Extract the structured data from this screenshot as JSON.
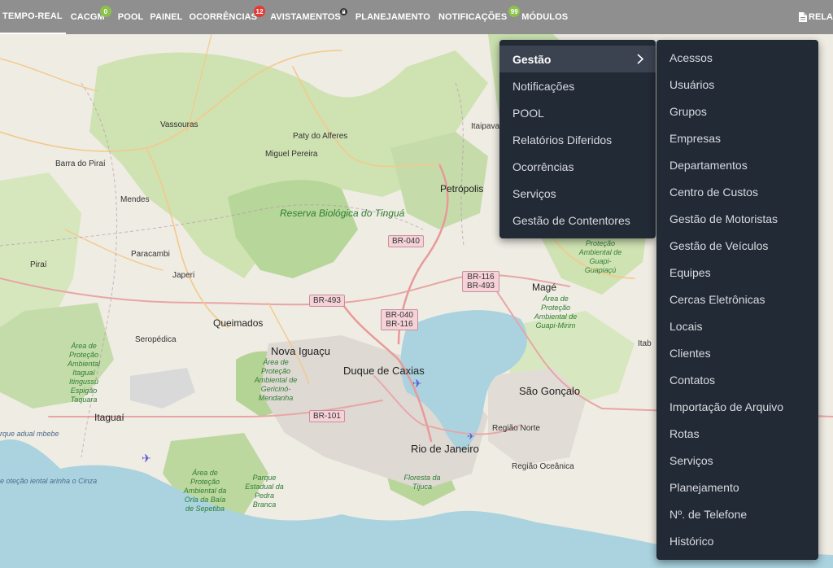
{
  "topbar": {
    "items": [
      {
        "label": "TEMPO-REAL"
      },
      {
        "label": "CACGM",
        "badge": "0"
      },
      {
        "label": "POOL"
      },
      {
        "label": "PAINEL"
      },
      {
        "label": "OCORRÊNCIAS",
        "badge": "12"
      },
      {
        "label": "AVISTAMENTOS"
      },
      {
        "label": "PLANEJAMENTO"
      },
      {
        "label": "NOTIFICAÇÕES",
        "badge": "99"
      },
      {
        "label": "MÓDULOS"
      }
    ],
    "right_label": "RELA",
    "colors": {
      "bar": "#8f8f8f",
      "badge_green": "#8bc34a",
      "badge_red": "#e53935"
    }
  },
  "menu": {
    "items": [
      {
        "label": "Gestão"
      },
      {
        "label": "Notificações"
      },
      {
        "label": "POOL"
      },
      {
        "label": "Relatórios Diferidos"
      },
      {
        "label": "Ocorrências"
      },
      {
        "label": "Serviços"
      },
      {
        "label": "Gestão de Contentores"
      }
    ]
  },
  "submenu": {
    "items": [
      {
        "label": "Acessos"
      },
      {
        "label": "Usuários"
      },
      {
        "label": "Grupos"
      },
      {
        "label": "Empresas"
      },
      {
        "label": "Departamentos"
      },
      {
        "label": "Centro de Custos"
      },
      {
        "label": "Gestão de Motoristas"
      },
      {
        "label": "Gestão de Veículos"
      },
      {
        "label": "Equipes"
      },
      {
        "label": "Cercas Eletrônicas"
      },
      {
        "label": "Locais"
      },
      {
        "label": "Clientes"
      },
      {
        "label": "Contatos"
      },
      {
        "label": "Importação de Arquivo"
      },
      {
        "label": "Rotas"
      },
      {
        "label": "Serviços"
      },
      {
        "label": "Planejamento"
      },
      {
        "label": "Nº. de Telefone"
      },
      {
        "label": "Histórico"
      }
    ]
  },
  "map": {
    "places": {
      "vassouras": "Vassouras",
      "paty": "Paty do Alferes",
      "miguel": "Miguel Pereira",
      "barra": "Barra do Piraí",
      "mendes": "Mendes",
      "itaipava": "Itaipava",
      "petropolis": "Petrópolis",
      "reserva": "Reserva Biológica do Tinguá",
      "pirai": "Piraí",
      "paracambi": "Paracambi",
      "japeri": "Japeri",
      "queimados": "Queimados",
      "mage": "Magé",
      "seropedica": "Seropédica",
      "novaiguacu": "Nova Iguaçu",
      "caxias": "Duque de Caxias",
      "itaguai": "Itaguaí",
      "saogoncalo": "São Gonçalo",
      "rio": "Rio de Janeiro",
      "regiaonorte": "Região Norte",
      "regiaooceanica": "Região Oceânica",
      "itab": "Itab",
      "apa_itaguai": "Área de Proteção Ambiental Itaguaí Itingussú Espigão Taquara",
      "apa_gericino": "Área de Proteção Ambiental de Gericinó-Mendanha",
      "apa_guapi_g": "Proteção Ambiental de Guapi-Guapiaçú",
      "apa_guapi_m": "Área de Proteção Ambiental de Guapi-Mirim",
      "apa_orla": "Área de Proteção Ambiental da Orla da Baía de Sepetiba",
      "pedrabranca": "Parque Estadual da Pedra Branca",
      "tijuca": "Floresta da Tijuca",
      "left_coast": "rque adual mbebe",
      "left_coast2": "e oteção iental arinha o Cinza"
    },
    "roads": [
      "BR-040",
      "BR-116",
      "BR-493",
      "BR-493",
      "BR-040",
      "BR-116",
      "BR-101"
    ]
  }
}
